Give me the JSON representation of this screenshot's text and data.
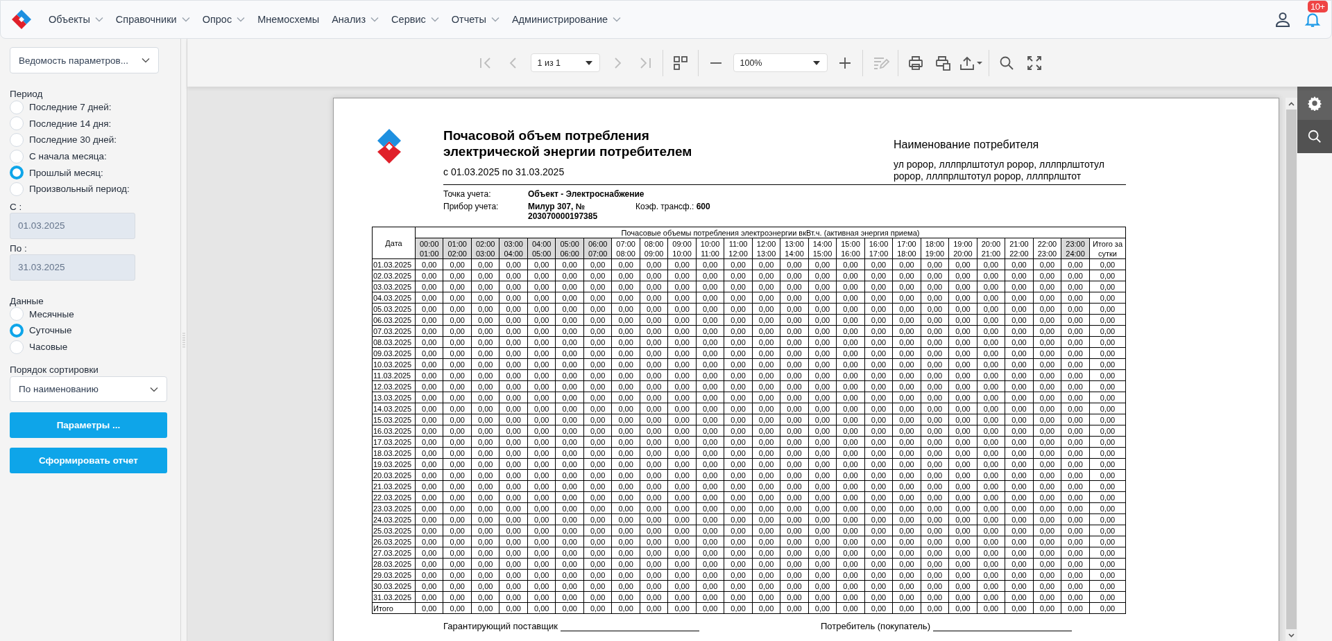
{
  "navbar": {
    "menu": [
      {
        "label": "Объекты",
        "has_dropdown": true
      },
      {
        "label": "Справочники",
        "has_dropdown": true
      },
      {
        "label": "Опрос",
        "has_dropdown": true
      },
      {
        "label": "Мнемосхемы",
        "has_dropdown": false
      },
      {
        "label": "Анализ",
        "has_dropdown": true
      },
      {
        "label": "Сервис",
        "has_dropdown": true
      },
      {
        "label": "Отчеты",
        "has_dropdown": true
      },
      {
        "label": "Администрирование",
        "has_dropdown": true
      }
    ],
    "notifications_badge": "10+"
  },
  "filters": {
    "report_select": "Ведомость параметров...",
    "period": {
      "label": "Период",
      "options": [
        {
          "label": "Последние 7 дней:",
          "selected": false
        },
        {
          "label": "Последние 14 дня:",
          "selected": false
        },
        {
          "label": "Последние 30 дней:",
          "selected": false
        },
        {
          "label": "С начала месяца:",
          "selected": false
        },
        {
          "label": "Прошлый месяц:",
          "selected": true
        },
        {
          "label": "Произвольный период:",
          "selected": false
        }
      ]
    },
    "date_from": {
      "label": "С :",
      "value": "01.03.2025",
      "disabled": true
    },
    "date_to": {
      "label": "По :",
      "value": "31.03.2025",
      "disabled": true
    },
    "data": {
      "label": "Данные",
      "options": [
        {
          "label": "Месячные",
          "selected": false
        },
        {
          "label": "Суточные",
          "selected": true
        },
        {
          "label": "Часовые",
          "selected": false
        }
      ]
    },
    "sort": {
      "label": "Порядок сортировки",
      "value": "По наименованию"
    },
    "buttons": [
      "Параметры ...",
      "Сформировать отчет"
    ]
  },
  "toolbar": {
    "first_page": {
      "disabled": true
    },
    "prev_page": {
      "disabled": true
    },
    "page_select": {
      "value": "1 из 1"
    },
    "next_page": {
      "disabled": true
    },
    "last_page": {
      "disabled": true
    },
    "zoom_select": {
      "value": "100%"
    },
    "edit": {
      "disabled": true
    }
  },
  "report": {
    "title": "Почасовой объем потребления электрической энергии потребителем",
    "period": "с 01.03.2025 по 31.03.2025",
    "consumer_heading": "Наименование потребителя",
    "consumer_address": "ул ророр, лллпрлштотул ророр, лллпрлштотул ророр, лллпрлштотул ророр, лллпрлштот",
    "metering_point_label": "Точка учета:",
    "metering_point": "Объект - Электроснабжение",
    "meter_label": "Прибор учета:",
    "meter": "Милур 307,  № 203070000197385",
    "ratio_label": "Коэф. трансф.:",
    "ratio": "600",
    "table": {
      "date_header": "Дата",
      "group_header": "Почасовые объемы потребления электроэнергии вкВт.ч. (активная энергия приема)",
      "total_header": "Итого за сутки",
      "hours": [
        {
          "from": "00:00",
          "to": "01:00",
          "shaded": true
        },
        {
          "from": "01:00",
          "to": "02:00",
          "shaded": true
        },
        {
          "from": "02:00",
          "to": "03:00",
          "shaded": true
        },
        {
          "from": "03:00",
          "to": "04:00",
          "shaded": true
        },
        {
          "from": "04:00",
          "to": "05:00",
          "shaded": true
        },
        {
          "from": "05:00",
          "to": "06:00",
          "shaded": true
        },
        {
          "from": "06:00",
          "to": "07:00",
          "shaded": true
        },
        {
          "from": "07:00",
          "to": "08:00",
          "shaded": false
        },
        {
          "from": "08:00",
          "to": "09:00",
          "shaded": false
        },
        {
          "from": "09:00",
          "to": "10:00",
          "shaded": false
        },
        {
          "from": "10:00",
          "to": "11:00",
          "shaded": false
        },
        {
          "from": "11:00",
          "to": "12:00",
          "shaded": false
        },
        {
          "from": "12:00",
          "to": "13:00",
          "shaded": false
        },
        {
          "from": "13:00",
          "to": "14:00",
          "shaded": false
        },
        {
          "from": "14:00",
          "to": "15:00",
          "shaded": false
        },
        {
          "from": "15:00",
          "to": "16:00",
          "shaded": false
        },
        {
          "from": "16:00",
          "to": "17:00",
          "shaded": false
        },
        {
          "from": "17:00",
          "to": "18:00",
          "shaded": false
        },
        {
          "from": "18:00",
          "to": "19:00",
          "shaded": false
        },
        {
          "from": "19:00",
          "to": "20:00",
          "shaded": false
        },
        {
          "from": "20:00",
          "to": "21:00",
          "shaded": false
        },
        {
          "from": "21:00",
          "to": "22:00",
          "shaded": false
        },
        {
          "from": "22:00",
          "to": "23:00",
          "shaded": false
        },
        {
          "from": "23:00",
          "to": "24:00",
          "shaded": true
        }
      ],
      "rows": [
        {
          "date": "01.03.2025",
          "values": [
            "0,00",
            "0,00",
            "0,00",
            "0,00",
            "0,00",
            "0,00",
            "0,00",
            "0,00",
            "0,00",
            "0,00",
            "0,00",
            "0,00",
            "0,00",
            "0,00",
            "0,00",
            "0,00",
            "0,00",
            "0,00",
            "0,00",
            "0,00",
            "0,00",
            "0,00",
            "0,00",
            "0,00",
            "0,00"
          ]
        },
        {
          "date": "02.03.2025",
          "values": [
            "0,00",
            "0,00",
            "0,00",
            "0,00",
            "0,00",
            "0,00",
            "0,00",
            "0,00",
            "0,00",
            "0,00",
            "0,00",
            "0,00",
            "0,00",
            "0,00",
            "0,00",
            "0,00",
            "0,00",
            "0,00",
            "0,00",
            "0,00",
            "0,00",
            "0,00",
            "0,00",
            "0,00",
            "0,00"
          ]
        },
        {
          "date": "03.03.2025",
          "values": [
            "0,00",
            "0,00",
            "0,00",
            "0,00",
            "0,00",
            "0,00",
            "0,00",
            "0,00",
            "0,00",
            "0,00",
            "0,00",
            "0,00",
            "0,00",
            "0,00",
            "0,00",
            "0,00",
            "0,00",
            "0,00",
            "0,00",
            "0,00",
            "0,00",
            "0,00",
            "0,00",
            "0,00",
            "0,00"
          ]
        },
        {
          "date": "04.03.2025",
          "values": [
            "0,00",
            "0,00",
            "0,00",
            "0,00",
            "0,00",
            "0,00",
            "0,00",
            "0,00",
            "0,00",
            "0,00",
            "0,00",
            "0,00",
            "0,00",
            "0,00",
            "0,00",
            "0,00",
            "0,00",
            "0,00",
            "0,00",
            "0,00",
            "0,00",
            "0,00",
            "0,00",
            "0,00",
            "0,00"
          ]
        },
        {
          "date": "05.03.2025",
          "values": [
            "0,00",
            "0,00",
            "0,00",
            "0,00",
            "0,00",
            "0,00",
            "0,00",
            "0,00",
            "0,00",
            "0,00",
            "0,00",
            "0,00",
            "0,00",
            "0,00",
            "0,00",
            "0,00",
            "0,00",
            "0,00",
            "0,00",
            "0,00",
            "0,00",
            "0,00",
            "0,00",
            "0,00",
            "0,00"
          ]
        },
        {
          "date": "06.03.2025",
          "values": [
            "0,00",
            "0,00",
            "0,00",
            "0,00",
            "0,00",
            "0,00",
            "0,00",
            "0,00",
            "0,00",
            "0,00",
            "0,00",
            "0,00",
            "0,00",
            "0,00",
            "0,00",
            "0,00",
            "0,00",
            "0,00",
            "0,00",
            "0,00",
            "0,00",
            "0,00",
            "0,00",
            "0,00",
            "0,00"
          ]
        },
        {
          "date": "07.03.2025",
          "values": [
            "0,00",
            "0,00",
            "0,00",
            "0,00",
            "0,00",
            "0,00",
            "0,00",
            "0,00",
            "0,00",
            "0,00",
            "0,00",
            "0,00",
            "0,00",
            "0,00",
            "0,00",
            "0,00",
            "0,00",
            "0,00",
            "0,00",
            "0,00",
            "0,00",
            "0,00",
            "0,00",
            "0,00",
            "0,00"
          ]
        },
        {
          "date": "08.03.2025",
          "values": [
            "0,00",
            "0,00",
            "0,00",
            "0,00",
            "0,00",
            "0,00",
            "0,00",
            "0,00",
            "0,00",
            "0,00",
            "0,00",
            "0,00",
            "0,00",
            "0,00",
            "0,00",
            "0,00",
            "0,00",
            "0,00",
            "0,00",
            "0,00",
            "0,00",
            "0,00",
            "0,00",
            "0,00",
            "0,00"
          ]
        },
        {
          "date": "09.03.2025",
          "values": [
            "0,00",
            "0,00",
            "0,00",
            "0,00",
            "0,00",
            "0,00",
            "0,00",
            "0,00",
            "0,00",
            "0,00",
            "0,00",
            "0,00",
            "0,00",
            "0,00",
            "0,00",
            "0,00",
            "0,00",
            "0,00",
            "0,00",
            "0,00",
            "0,00",
            "0,00",
            "0,00",
            "0,00",
            "0,00"
          ]
        },
        {
          "date": "10.03.2025",
          "values": [
            "0,00",
            "0,00",
            "0,00",
            "0,00",
            "0,00",
            "0,00",
            "0,00",
            "0,00",
            "0,00",
            "0,00",
            "0,00",
            "0,00",
            "0,00",
            "0,00",
            "0,00",
            "0,00",
            "0,00",
            "0,00",
            "0,00",
            "0,00",
            "0,00",
            "0,00",
            "0,00",
            "0,00",
            "0,00"
          ]
        },
        {
          "date": "11.03.2025",
          "values": [
            "0,00",
            "0,00",
            "0,00",
            "0,00",
            "0,00",
            "0,00",
            "0,00",
            "0,00",
            "0,00",
            "0,00",
            "0,00",
            "0,00",
            "0,00",
            "0,00",
            "0,00",
            "0,00",
            "0,00",
            "0,00",
            "0,00",
            "0,00",
            "0,00",
            "0,00",
            "0,00",
            "0,00",
            "0,00"
          ]
        },
        {
          "date": "12.03.2025",
          "values": [
            "0,00",
            "0,00",
            "0,00",
            "0,00",
            "0,00",
            "0,00",
            "0,00",
            "0,00",
            "0,00",
            "0,00",
            "0,00",
            "0,00",
            "0,00",
            "0,00",
            "0,00",
            "0,00",
            "0,00",
            "0,00",
            "0,00",
            "0,00",
            "0,00",
            "0,00",
            "0,00",
            "0,00",
            "0,00"
          ]
        },
        {
          "date": "13.03.2025",
          "values": [
            "0,00",
            "0,00",
            "0,00",
            "0,00",
            "0,00",
            "0,00",
            "0,00",
            "0,00",
            "0,00",
            "0,00",
            "0,00",
            "0,00",
            "0,00",
            "0,00",
            "0,00",
            "0,00",
            "0,00",
            "0,00",
            "0,00",
            "0,00",
            "0,00",
            "0,00",
            "0,00",
            "0,00",
            "0,00"
          ]
        },
        {
          "date": "14.03.2025",
          "values": [
            "0,00",
            "0,00",
            "0,00",
            "0,00",
            "0,00",
            "0,00",
            "0,00",
            "0,00",
            "0,00",
            "0,00",
            "0,00",
            "0,00",
            "0,00",
            "0,00",
            "0,00",
            "0,00",
            "0,00",
            "0,00",
            "0,00",
            "0,00",
            "0,00",
            "0,00",
            "0,00",
            "0,00",
            "0,00"
          ]
        },
        {
          "date": "15.03.2025",
          "values": [
            "0,00",
            "0,00",
            "0,00",
            "0,00",
            "0,00",
            "0,00",
            "0,00",
            "0,00",
            "0,00",
            "0,00",
            "0,00",
            "0,00",
            "0,00",
            "0,00",
            "0,00",
            "0,00",
            "0,00",
            "0,00",
            "0,00",
            "0,00",
            "0,00",
            "0,00",
            "0,00",
            "0,00",
            "0,00"
          ]
        },
        {
          "date": "16.03.2025",
          "values": [
            "0,00",
            "0,00",
            "0,00",
            "0,00",
            "0,00",
            "0,00",
            "0,00",
            "0,00",
            "0,00",
            "0,00",
            "0,00",
            "0,00",
            "0,00",
            "0,00",
            "0,00",
            "0,00",
            "0,00",
            "0,00",
            "0,00",
            "0,00",
            "0,00",
            "0,00",
            "0,00",
            "0,00",
            "0,00"
          ]
        },
        {
          "date": "17.03.2025",
          "values": [
            "0,00",
            "0,00",
            "0,00",
            "0,00",
            "0,00",
            "0,00",
            "0,00",
            "0,00",
            "0,00",
            "0,00",
            "0,00",
            "0,00",
            "0,00",
            "0,00",
            "0,00",
            "0,00",
            "0,00",
            "0,00",
            "0,00",
            "0,00",
            "0,00",
            "0,00",
            "0,00",
            "0,00",
            "0,00"
          ]
        },
        {
          "date": "18.03.2025",
          "values": [
            "0,00",
            "0,00",
            "0,00",
            "0,00",
            "0,00",
            "0,00",
            "0,00",
            "0,00",
            "0,00",
            "0,00",
            "0,00",
            "0,00",
            "0,00",
            "0,00",
            "0,00",
            "0,00",
            "0,00",
            "0,00",
            "0,00",
            "0,00",
            "0,00",
            "0,00",
            "0,00",
            "0,00",
            "0,00"
          ]
        },
        {
          "date": "19.03.2025",
          "values": [
            "0,00",
            "0,00",
            "0,00",
            "0,00",
            "0,00",
            "0,00",
            "0,00",
            "0,00",
            "0,00",
            "0,00",
            "0,00",
            "0,00",
            "0,00",
            "0,00",
            "0,00",
            "0,00",
            "0,00",
            "0,00",
            "0,00",
            "0,00",
            "0,00",
            "0,00",
            "0,00",
            "0,00",
            "0,00"
          ]
        },
        {
          "date": "20.03.2025",
          "values": [
            "0,00",
            "0,00",
            "0,00",
            "0,00",
            "0,00",
            "0,00",
            "0,00",
            "0,00",
            "0,00",
            "0,00",
            "0,00",
            "0,00",
            "0,00",
            "0,00",
            "0,00",
            "0,00",
            "0,00",
            "0,00",
            "0,00",
            "0,00",
            "0,00",
            "0,00",
            "0,00",
            "0,00",
            "0,00"
          ]
        },
        {
          "date": "21.03.2025",
          "values": [
            "0,00",
            "0,00",
            "0,00",
            "0,00",
            "0,00",
            "0,00",
            "0,00",
            "0,00",
            "0,00",
            "0,00",
            "0,00",
            "0,00",
            "0,00",
            "0,00",
            "0,00",
            "0,00",
            "0,00",
            "0,00",
            "0,00",
            "0,00",
            "0,00",
            "0,00",
            "0,00",
            "0,00",
            "0,00"
          ]
        },
        {
          "date": "22.03.2025",
          "values": [
            "0,00",
            "0,00",
            "0,00",
            "0,00",
            "0,00",
            "0,00",
            "0,00",
            "0,00",
            "0,00",
            "0,00",
            "0,00",
            "0,00",
            "0,00",
            "0,00",
            "0,00",
            "0,00",
            "0,00",
            "0,00",
            "0,00",
            "0,00",
            "0,00",
            "0,00",
            "0,00",
            "0,00",
            "0,00"
          ]
        },
        {
          "date": "23.03.2025",
          "values": [
            "0,00",
            "0,00",
            "0,00",
            "0,00",
            "0,00",
            "0,00",
            "0,00",
            "0,00",
            "0,00",
            "0,00",
            "0,00",
            "0,00",
            "0,00",
            "0,00",
            "0,00",
            "0,00",
            "0,00",
            "0,00",
            "0,00",
            "0,00",
            "0,00",
            "0,00",
            "0,00",
            "0,00",
            "0,00"
          ]
        },
        {
          "date": "24.03.2025",
          "values": [
            "0,00",
            "0,00",
            "0,00",
            "0,00",
            "0,00",
            "0,00",
            "0,00",
            "0,00",
            "0,00",
            "0,00",
            "0,00",
            "0,00",
            "0,00",
            "0,00",
            "0,00",
            "0,00",
            "0,00",
            "0,00",
            "0,00",
            "0,00",
            "0,00",
            "0,00",
            "0,00",
            "0,00",
            "0,00"
          ]
        },
        {
          "date": "25.03.2025",
          "values": [
            "0,00",
            "0,00",
            "0,00",
            "0,00",
            "0,00",
            "0,00",
            "0,00",
            "0,00",
            "0,00",
            "0,00",
            "0,00",
            "0,00",
            "0,00",
            "0,00",
            "0,00",
            "0,00",
            "0,00",
            "0,00",
            "0,00",
            "0,00",
            "0,00",
            "0,00",
            "0,00",
            "0,00",
            "0,00"
          ]
        },
        {
          "date": "26.03.2025",
          "values": [
            "0,00",
            "0,00",
            "0,00",
            "0,00",
            "0,00",
            "0,00",
            "0,00",
            "0,00",
            "0,00",
            "0,00",
            "0,00",
            "0,00",
            "0,00",
            "0,00",
            "0,00",
            "0,00",
            "0,00",
            "0,00",
            "0,00",
            "0,00",
            "0,00",
            "0,00",
            "0,00",
            "0,00",
            "0,00"
          ]
        },
        {
          "date": "27.03.2025",
          "values": [
            "0,00",
            "0,00",
            "0,00",
            "0,00",
            "0,00",
            "0,00",
            "0,00",
            "0,00",
            "0,00",
            "0,00",
            "0,00",
            "0,00",
            "0,00",
            "0,00",
            "0,00",
            "0,00",
            "0,00",
            "0,00",
            "0,00",
            "0,00",
            "0,00",
            "0,00",
            "0,00",
            "0,00",
            "0,00"
          ]
        },
        {
          "date": "28.03.2025",
          "values": [
            "0,00",
            "0,00",
            "0,00",
            "0,00",
            "0,00",
            "0,00",
            "0,00",
            "0,00",
            "0,00",
            "0,00",
            "0,00",
            "0,00",
            "0,00",
            "0,00",
            "0,00",
            "0,00",
            "0,00",
            "0,00",
            "0,00",
            "0,00",
            "0,00",
            "0,00",
            "0,00",
            "0,00",
            "0,00"
          ]
        },
        {
          "date": "29.03.2025",
          "values": [
            "0,00",
            "0,00",
            "0,00",
            "0,00",
            "0,00",
            "0,00",
            "0,00",
            "0,00",
            "0,00",
            "0,00",
            "0,00",
            "0,00",
            "0,00",
            "0,00",
            "0,00",
            "0,00",
            "0,00",
            "0,00",
            "0,00",
            "0,00",
            "0,00",
            "0,00",
            "0,00",
            "0,00",
            "0,00"
          ]
        },
        {
          "date": "30.03.2025",
          "values": [
            "0,00",
            "0,00",
            "0,00",
            "0,00",
            "0,00",
            "0,00",
            "0,00",
            "0,00",
            "0,00",
            "0,00",
            "0,00",
            "0,00",
            "0,00",
            "0,00",
            "0,00",
            "0,00",
            "0,00",
            "0,00",
            "0,00",
            "0,00",
            "0,00",
            "0,00",
            "0,00",
            "0,00",
            "0,00"
          ]
        },
        {
          "date": "31.03.2025",
          "values": [
            "0,00",
            "0,00",
            "0,00",
            "0,00",
            "0,00",
            "0,00",
            "0,00",
            "0,00",
            "0,00",
            "0,00",
            "0,00",
            "0,00",
            "0,00",
            "0,00",
            "0,00",
            "0,00",
            "0,00",
            "0,00",
            "0,00",
            "0,00",
            "0,00",
            "0,00",
            "0,00",
            "0,00",
            "0,00"
          ]
        }
      ],
      "total": {
        "label": "Итого",
        "values": [
          "0,00",
          "0,00",
          "0,00",
          "0,00",
          "0,00",
          "0,00",
          "0,00",
          "0,00",
          "0,00",
          "0,00",
          "0,00",
          "0,00",
          "0,00",
          "0,00",
          "0,00",
          "0,00",
          "0,00",
          "0,00",
          "0,00",
          "0,00",
          "0,00",
          "0,00",
          "0,00",
          "0,00",
          "0,00"
        ]
      }
    },
    "signatures": [
      "Гарантирующий поставщик",
      "Потребитель (покупатель)"
    ]
  }
}
